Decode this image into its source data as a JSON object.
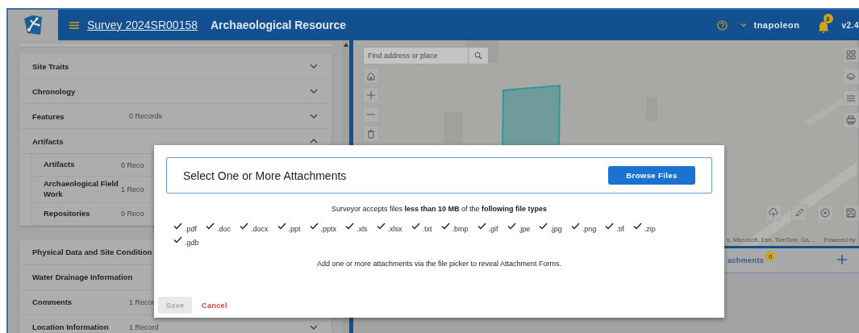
{
  "header": {
    "survey_link": "Survey 2024SR00158",
    "title": "Archaeological Resource",
    "username": "tnapoleon",
    "notification_count": "3",
    "version": "v2.4"
  },
  "section_groups": [
    {
      "sections": [
        {
          "label": "Site Traits",
          "expanded": false
        },
        {
          "label": "Chronology",
          "expanded": false
        },
        {
          "label": "Features",
          "records": "0 Records",
          "expanded": false
        },
        {
          "label": "Artifacts",
          "expanded": true,
          "children": [
            {
              "label": "Artifacts",
              "records": "0 Reco"
            },
            {
              "label": "Archaeological Field Work",
              "records": "1 Reco"
            },
            {
              "label": "Repositories",
              "records": "0 Reco"
            }
          ]
        }
      ]
    },
    {
      "sections": [
        {
          "label": "Physical Data and Site Condition"
        },
        {
          "label": "Water Drainage Information"
        },
        {
          "label": "Comments",
          "records": "1 Recor"
        },
        {
          "label": "Location Information",
          "records": "1 Record",
          "expanded": false
        }
      ]
    }
  ],
  "map": {
    "search": {
      "placeholder": "Find address or place"
    },
    "attribution": "s, Microsoft, Esri, TomTom, Ga...",
    "powered_by": "Powered by",
    "attachments_tab": "achments",
    "attachments_count": "0"
  },
  "dialog": {
    "title": "Select One or More Attachments",
    "browse_button": "Browse Files",
    "info": "Surveyor accepts files **less than 10 MB** of the **following file types**",
    "file_types": [
      ".pdf",
      ".doc",
      ".docx",
      ".ppt",
      ".pptx",
      ".xls",
      ".xlsx",
      ".txt",
      ".bmp",
      ".gif",
      ".jpe",
      ".jpg",
      ".png",
      ".tif",
      ".zip",
      ".gdb"
    ],
    "hint": "Add one or more attachments via the file picker to reveal Attachment Forms.",
    "save_button": {
      "label": "Save",
      "disabled": true
    },
    "cancel_button": "Cancel"
  }
}
